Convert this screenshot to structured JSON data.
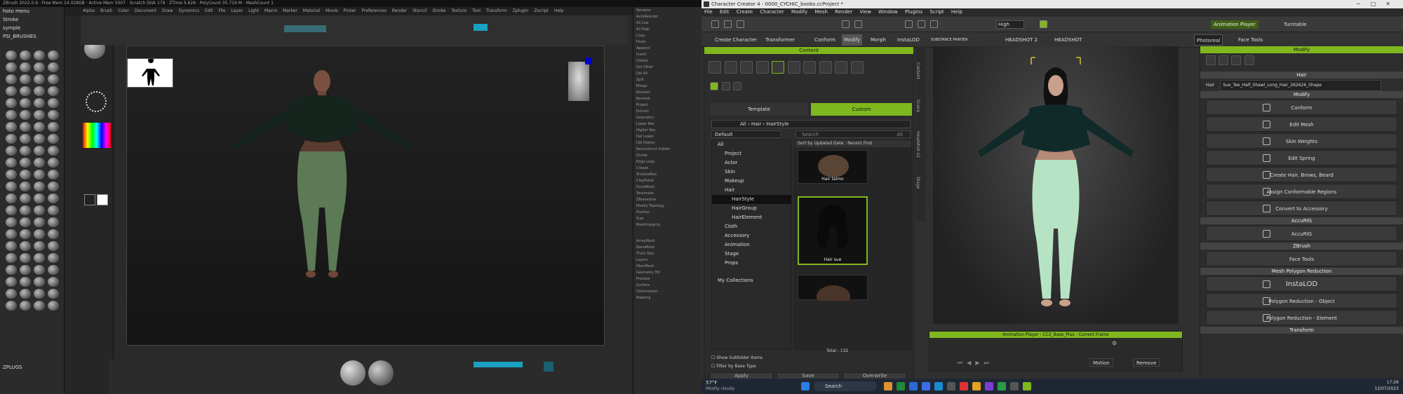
{
  "zbrush": {
    "title": "ZBrush 2022.0.6 · Free Mem 14.028GB · Active Mem 5007 · Scratch Disk 179 · ZTime 5.626 · PolyCount 35.719 M · MeshCount 1",
    "menu": [
      "Alpha",
      "Brush",
      "Color",
      "Document",
      "Draw",
      "Dynamics",
      "Edit",
      "File",
      "Layer",
      "Light",
      "Macro",
      "Marker",
      "Material",
      "Movie",
      "Picker",
      "Preferences",
      "Render",
      "Stencil",
      "Stroke",
      "Texture",
      "Tool",
      "Transform",
      "Zplugin",
      "Zscript",
      "Help"
    ],
    "left_labels": [
      "hoto menu",
      "Stroke",
      "symple",
      "PSI_BRUSHES"
    ],
    "bottom_label": "ZPLUGS",
    "right_items": [
      "Rename",
      "AutoReorder",
      "All Low",
      "All High",
      "Copy",
      "Paste",
      "Append",
      "Insert",
      "Delete",
      "Del Other",
      "Del All",
      "Split",
      "Merge",
      "Boolean",
      "Remesh",
      "Project",
      "Extract",
      "Geometry",
      "Lower Res",
      "Higher Res",
      "Del Lower",
      "Del Higher",
      "Reconstruct Subdiv",
      "Divide",
      "Edge Loop",
      "Crease",
      "ShadowBox",
      "ClayPolish",
      "DynaMesh",
      "Tessimate",
      "ZRemesher",
      "Modify Topology",
      "Position",
      "Size",
      "MeshIntegrity"
    ],
    "right_bottom": [
      "ArrayMesh",
      "NanoMesh",
      "Thick Skin",
      "Layers",
      "FiberMesh",
      "Geometry HD",
      "Preview",
      "Surface",
      "Deformation",
      "Masking"
    ]
  },
  "cc": {
    "title": "Character Creator 4 - 0000_CYCHIC_boobs.ccProject *",
    "menu": [
      "File",
      "Edit",
      "Create",
      "Character",
      "Modify",
      "Mesh",
      "Render",
      "View",
      "Window",
      "Plugins",
      "Script",
      "Help"
    ],
    "quality": "High",
    "toolbar2": [
      "Create Character",
      "Transformer",
      "Conform",
      "Modify",
      "Morph",
      "InstaLOD",
      "SUBSTANCE PAINTER",
      "HEADSHOT 2",
      "HEADSHOT",
      "Photoreal",
      "Face Tools"
    ],
    "anim_label": "Animation Player",
    "turntable": "Turntable",
    "content": {
      "header": "Content",
      "tabs": [
        "Template",
        "Custom"
      ],
      "breadcrumb": "All › Hair › HairStyle",
      "filter": "Default",
      "search_placeholder": "Search",
      "search_scope": "All",
      "sort": "Sort by Updated Date : Recent First",
      "tree": [
        "All",
        "Project",
        "Actor",
        "Skin",
        "Makeup",
        "Hair",
        "HairStyle",
        "HairGroup",
        "HairElement",
        "Cloth",
        "Accessory",
        "Animation",
        "Stage",
        "Props"
      ],
      "collections": "My Collections",
      "items": [
        "Hair talmo",
        "Hair sue"
      ],
      "total": "Total : 132",
      "show_subfolder": "Show Subfolder Items",
      "filter_base": "Filter by Base Type",
      "apply": "Apply",
      "save": "Save",
      "overwrite": "Overwrite"
    },
    "side_tabs": [
      "Content",
      "Scene",
      "Headshot v2",
      "Stage"
    ],
    "anim_player": {
      "title": "Animation Player : CC3_Base_Plus - Current Frame",
      "motion": "Motion",
      "remove": "Remove"
    },
    "modify": {
      "header": "Modify",
      "hair_section": "Hair",
      "hair_field_label": "Hair",
      "hair_value": "Sue_Tee_Half_Shawl_Long_Hair_262626_Shape",
      "modify_section": "Modify",
      "buttons": [
        "Conform",
        "Edit Mesh",
        "Skin Weights",
        "Edit Spring",
        "Create Hair, Brows, Beard",
        "Assign Conformable Regions",
        "Convert to Accessory"
      ],
      "accurig_section": "AccuRIG",
      "accurig": "AccuRIG",
      "zbrush_section": "ZBrush",
      "face_tools": "Face Tools",
      "mpr_section": "Mesh Polygon Reduction",
      "instalod": "InstaLOD",
      "reduction_object": "Polygon Reduction - Object",
      "reduction_element": "Polygon Reduction - Element",
      "transform_section": "Transform"
    },
    "taskbar": {
      "weather_temp": "57°F",
      "weather_desc": "Mostly cloudy",
      "search": "Search",
      "time": "17:26",
      "date": "12/07/2023"
    }
  }
}
